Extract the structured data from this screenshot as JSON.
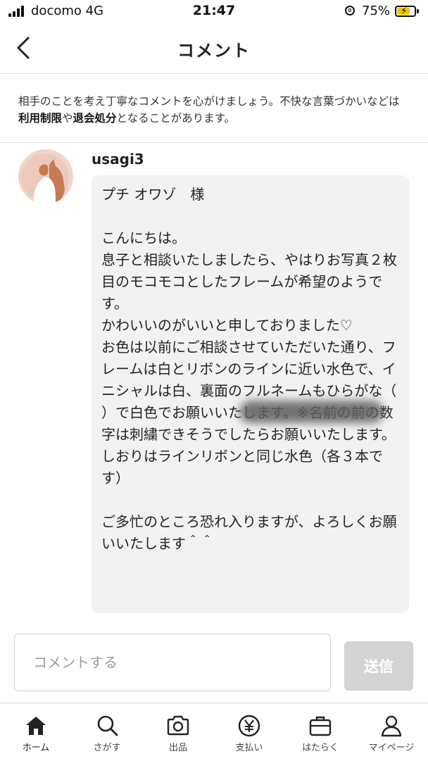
{
  "status_bar": {
    "carrier": "docomo  4G",
    "time": "21:47",
    "battery_percent": "75%",
    "battery_level": 0.75
  },
  "header": {
    "title": "コメント"
  },
  "notice": {
    "text_1": "相手のことを考え丁寧なコメントを心がけましょう。不快な言葉づかいなどは",
    "link_1": "利用制限",
    "text_2": "や",
    "link_2": "退会処分",
    "text_3": "となることがあります。"
  },
  "comment": {
    "username": "usagi3",
    "body": "プチ オワゾ　様\n\nこんにちは。\n息子と相談いたしましたら、やはりお写真２枚目のモコモコとしたフレームが希望のようです。\nかわいいのがいいと申しておりました♡\nお色は以前にご相談させていただいた通り、フレームは白とリボンのラインに近い水色で、イニシャルは白、裏面のフルネームもひらがな（　　　　　　　　）で白色でお願いいたします。※名前の前の数字は刺繍できそうでしたらお願いいたします。\nしおりはラインリボンと同じ水色（各３本です）\n\nご多忙のところ恐れ入りますが、よろしくお願いいたします＾＾"
  },
  "input": {
    "placeholder": "コメントする",
    "send_label": "送信"
  },
  "tabbar": {
    "items": [
      {
        "label": "ホーム",
        "icon": "home-icon"
      },
      {
        "label": "さがす",
        "icon": "search-icon"
      },
      {
        "label": "出品",
        "icon": "camera-icon"
      },
      {
        "label": "支払い",
        "icon": "yen-icon"
      },
      {
        "label": "はたらく",
        "icon": "briefcase-icon"
      },
      {
        "label": "マイページ",
        "icon": "person-icon"
      }
    ]
  }
}
